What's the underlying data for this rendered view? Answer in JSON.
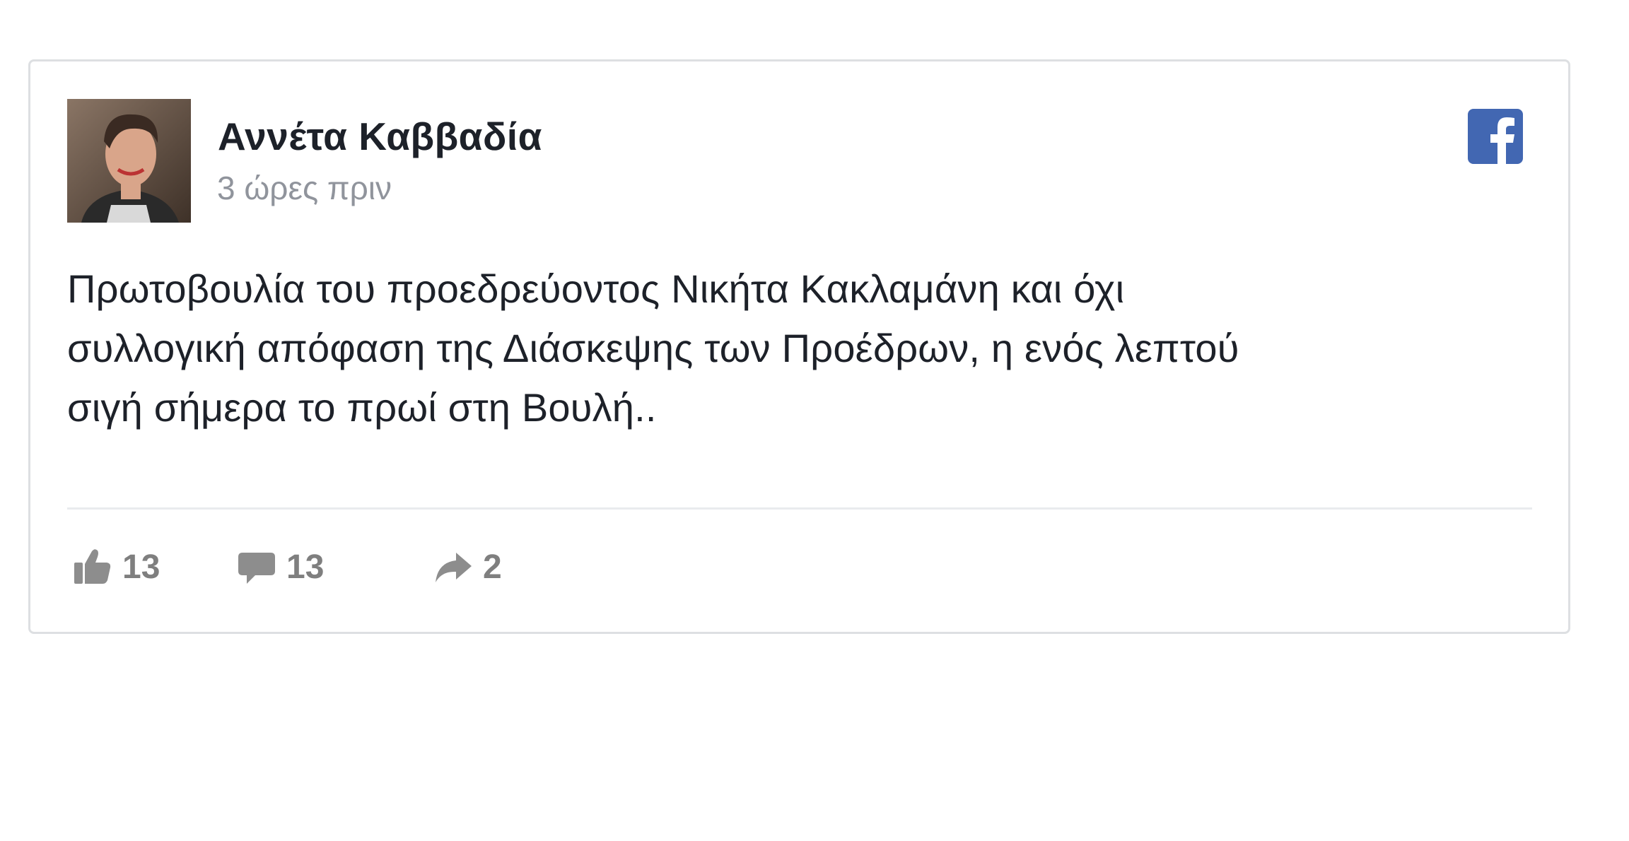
{
  "post": {
    "author_name": "Αννέτα Καββαδία",
    "timestamp": "3 ώρες πριν",
    "text_lines": [
      "Πρωτοβουλία του προεδρεύοντος Νικήτα Κακλαμάνη και όχι",
      "συλλογική απόφαση της Διάσκεψης των Προέδρων, η ενός λεπτού",
      "σιγή σήμερα το πρωί στη Βουλή.."
    ],
    "platform_icon": "facebook-icon"
  },
  "actions": {
    "likes": {
      "icon": "thumbs-up-icon",
      "count": "13"
    },
    "comments": {
      "icon": "comment-icon",
      "count": "13"
    },
    "shares": {
      "icon": "share-icon",
      "count": "2"
    }
  },
  "colors": {
    "facebook_blue": "#4267b2",
    "text_primary": "#1d2129",
    "text_secondary": "#90949c",
    "action_gray": "#7f7f7f",
    "border": "#dddfe2"
  }
}
